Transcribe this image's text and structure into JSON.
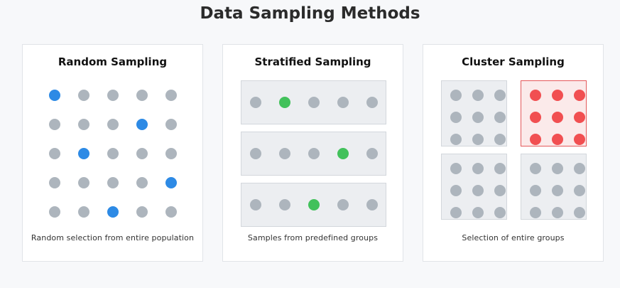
{
  "title": "Data Sampling Methods",
  "colors": {
    "unselected": "#adb5bd",
    "random_selected": "#2d8ae5",
    "stratified_selected": "#42c15b",
    "cluster_selected": "#f14f51"
  },
  "panels": {
    "random": {
      "title": "Random Sampling",
      "caption": "Random selection from entire population",
      "rows": 5,
      "cols": 5,
      "selected": [
        [
          0,
          0
        ],
        [
          1,
          3
        ],
        [
          2,
          1
        ],
        [
          3,
          4
        ],
        [
          4,
          2
        ]
      ]
    },
    "stratified": {
      "title": "Stratified Sampling",
      "caption": "Samples from predefined groups",
      "groups": 3,
      "items_per_group": 5,
      "selected_index": [
        1,
        3,
        2
      ]
    },
    "cluster": {
      "title": "Cluster Sampling",
      "caption": "Selection of entire groups",
      "clusters": 4,
      "items_per_side": 3,
      "selected_cluster": 1
    }
  }
}
